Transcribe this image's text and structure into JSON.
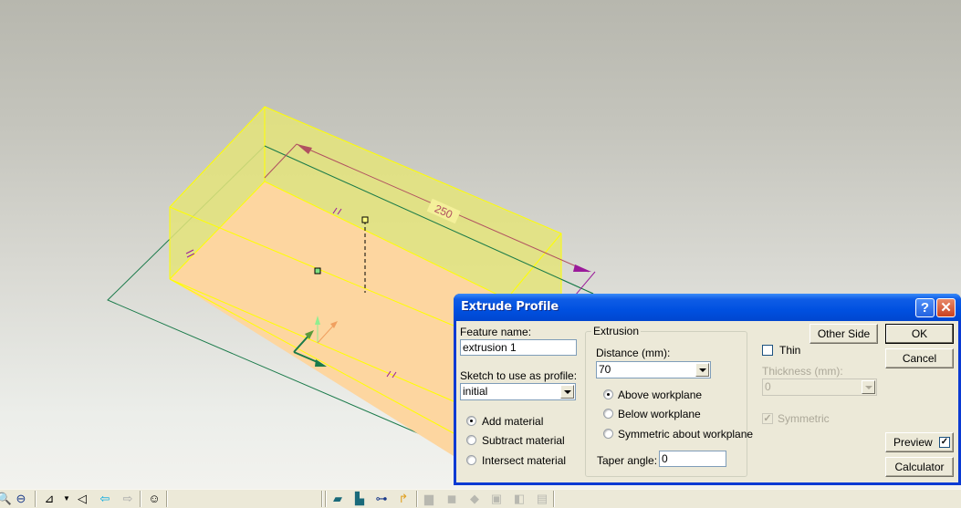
{
  "viewport": {
    "dimension_label": "250",
    "colors": {
      "top_face": "#e4e47a",
      "bottom_face": "#fdd6a0",
      "edge": "#ffff00",
      "sketch_plane": "#1a7a4a",
      "dimension_line": "#b05060",
      "dimension_arrow_end": "#9a1a9a"
    }
  },
  "dialog": {
    "title": "Extrude Profile",
    "help_label": "?",
    "close_label": "✕",
    "feature_name_label": "Feature name:",
    "feature_name_value": "extrusion 1",
    "sketch_label": "Sketch to use as profile:",
    "sketch_value": "initial",
    "material_options": [
      {
        "label": "Add material",
        "selected": true
      },
      {
        "label": "Subtract material",
        "selected": false
      },
      {
        "label": "Intersect material",
        "selected": false
      }
    ],
    "extrusion_group_label": "Extrusion",
    "distance_label": "Distance (mm):",
    "distance_value": "70",
    "direction_options": [
      {
        "label": "Above workplane",
        "selected": true
      },
      {
        "label": "Below workplane",
        "selected": false
      },
      {
        "label": "Symmetric about workplane",
        "selected": false
      }
    ],
    "taper_label": "Taper angle:",
    "taper_value": "0",
    "other_side_label": "Other Side",
    "thin_label": "Thin",
    "thin_checked": false,
    "thickness_label": "Thickness (mm):",
    "thickness_value": "0",
    "symmetric_label": "Symmetric",
    "symmetric_checked": true,
    "ok_label": "OK",
    "cancel_label": "Cancel",
    "preview_label": "Preview",
    "preview_checked": true,
    "calculator_label": "Calculator"
  },
  "toolbar": {
    "icons": [
      "zoom-window-icon",
      "zoom-out-icon",
      "workplane-icon",
      "dropdown-arrow-icon",
      "view-angle-icon",
      "back-arrow-icon",
      "forward-arrow-icon",
      "smiley-icon",
      "extrude-icon",
      "extrude-cut-icon",
      "revolve-icon",
      "sweep-icon",
      "hole-icon",
      "fillet-icon",
      "chamfer-icon",
      "shell-icon",
      "draft-icon",
      "pattern-icon"
    ]
  }
}
